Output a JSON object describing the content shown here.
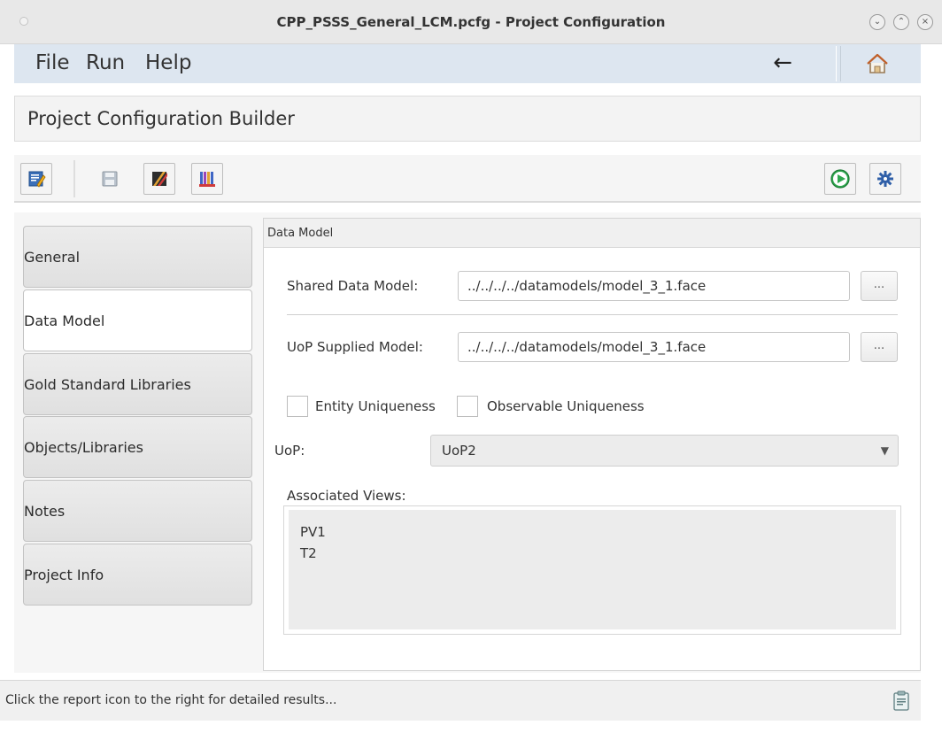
{
  "window": {
    "title": "CPP_PSSS_General_LCM.pcfg - Project Configuration",
    "controls": [
      "minimize-icon",
      "maximize-icon",
      "close-icon"
    ]
  },
  "menubar": {
    "items": [
      "File",
      "Run",
      "Help"
    ],
    "back_icon": "←",
    "home_icon": "home-icon"
  },
  "header": {
    "title": "Project Configuration Builder"
  },
  "toolbar": {
    "left_buttons": [
      "edit-project-icon",
      "save-icon",
      "edit-clear-icon",
      "library-books-icon"
    ],
    "right_buttons": [
      "run-icon",
      "settings-gear-icon"
    ]
  },
  "sidebar": {
    "items": [
      {
        "label": "General",
        "active": false
      },
      {
        "label": "Data Model",
        "active": true
      },
      {
        "label": "Gold Standard Libraries",
        "active": false
      },
      {
        "label": "Objects/Libraries",
        "active": false
      },
      {
        "label": "Notes",
        "active": false
      },
      {
        "label": "Project Info",
        "active": false
      }
    ]
  },
  "data_model": {
    "panel_title": "Data Model",
    "shared_label": "Shared Data Model:",
    "shared_value": "../../../../datamodels/model_3_1.face",
    "uop_supplied_label": "UoP Supplied Model:",
    "uop_supplied_value": "../../../../datamodels/model_3_1.face",
    "browse_label": "...",
    "entity_uniqueness_label": "Entity Uniqueness",
    "entity_uniqueness_checked": false,
    "observable_uniqueness_label": "Observable Uniqueness",
    "observable_uniqueness_checked": false,
    "uop_label": "UoP:",
    "uop_value": "UoP2",
    "associated_views_label": "Associated Views:",
    "associated_views": [
      "PV1",
      "T2"
    ]
  },
  "statusbar": {
    "text": "Click the report icon to the right for detailed results...",
    "report_icon": "report-clipboard-icon"
  },
  "colors": {
    "menubar_bg": "#dde6f0",
    "run_green": "#2fa84f",
    "settings_blue": "#2f5fa8"
  }
}
